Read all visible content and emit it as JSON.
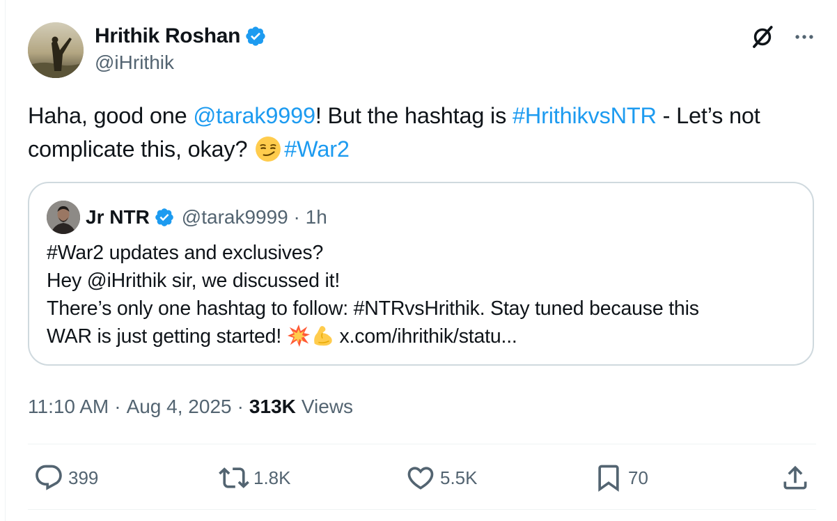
{
  "author": {
    "name": "Hrithik Roshan",
    "handle": "@iHrithik"
  },
  "tweet": {
    "part1": "Haha, good one ",
    "mention": "@tarak9999",
    "part2": "! But the hashtag is ",
    "hashtag1": "#HrithikvsNTR",
    "part3": " - Let’s not complicate this, okay?",
    "hashtag2": "#War2"
  },
  "quoted": {
    "name": "Jr NTR",
    "handle": "@tarak9999",
    "time": "1h",
    "lines": [
      "#War2 updates and exclusives?",
      "Hey @iHrithik sir, we discussed it!",
      "There’s only one hashtag to follow: #NTRvsHrithik. Stay tuned because this",
      "WAR is just getting started!"
    ],
    "link_text": "x.com/ihrithik/statu..."
  },
  "meta": {
    "time": "11:10 AM",
    "date": "Aug 4, 2025",
    "views_count": "313K",
    "views_label": "Views"
  },
  "actions": {
    "replies": "399",
    "reposts": "1.8K",
    "likes": "5.5K",
    "bookmarks": "70"
  },
  "icons": [
    "verified-icon",
    "grok-icon",
    "more-icon",
    "reply-icon",
    "repost-icon",
    "like-icon",
    "bookmark-icon",
    "share-icon"
  ],
  "colors": {
    "link": "#1d9bf0",
    "secondary_text": "#536471",
    "border": "#cfd9de",
    "verified": "#1d9bf0"
  }
}
